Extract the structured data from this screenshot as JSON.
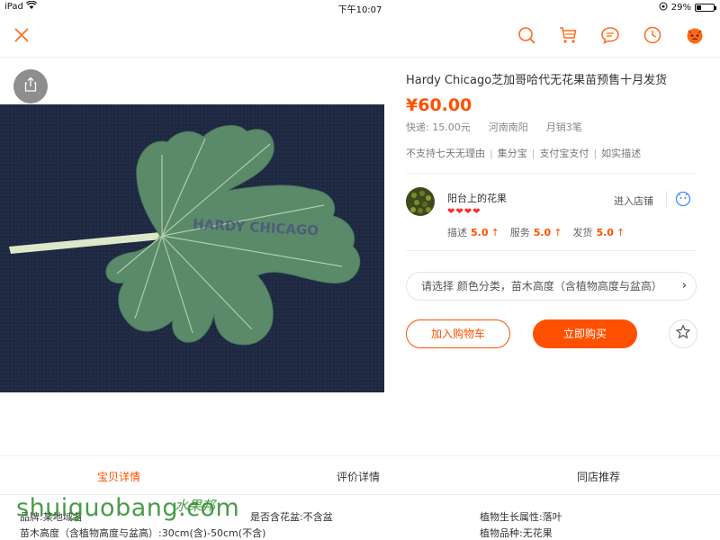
{
  "status_bar": {
    "device": "iPad",
    "time": "下午10:07",
    "battery_text": "29%",
    "battery_level": 0.29
  },
  "top_bar": {
    "icons": [
      "close-icon",
      "search-icon",
      "cart-icon",
      "message-icon",
      "history-icon",
      "profile-icon"
    ]
  },
  "product": {
    "title": "Hardy Chicago芝加哥哈代无花果苗预售十月发货",
    "price": "¥60.00",
    "shipping": "快递: 15.00元",
    "location": "河南南阳",
    "monthly_sales": "月销3笔",
    "image_label": "HARDY CHICAGO",
    "service_tags": [
      "不支持七天无理由",
      "集分宝",
      "支付宝支付",
      "如实描述"
    ]
  },
  "shop": {
    "name": "阳台上的花果",
    "hearts": "❤❤❤❤",
    "enter_label": "进入店铺",
    "ratings": [
      {
        "label": "描述",
        "score": "5.0"
      },
      {
        "label": "服务",
        "score": "5.0"
      },
      {
        "label": "发货",
        "score": "5.0"
      }
    ]
  },
  "sku_selector": {
    "text": "请选择 颜色分类，苗木高度（含植物高度与盆高）"
  },
  "actions": {
    "add_to_cart": "加入购物车",
    "buy_now": "立即购买"
  },
  "tabs": [
    {
      "label": "宝贝详情",
      "active": true
    },
    {
      "label": "评价详情",
      "active": false
    },
    {
      "label": "同店推荐",
      "active": false
    }
  ],
  "specs": {
    "brand": "品牌:某地域名",
    "pot_included": "是否含花盆:不含盆",
    "growth_attr": "植物生长属性:落叶",
    "height": "苗木高度（含植物高度与盆高）:30cm(含)-50cm(不含)",
    "species": "植物品种:无花果"
  },
  "watermark": {
    "latin": "shuiguobang.com",
    "chinese": "水果邦"
  },
  "colors": {
    "accent": "#ff5000",
    "heart": "#ff2d2d"
  }
}
